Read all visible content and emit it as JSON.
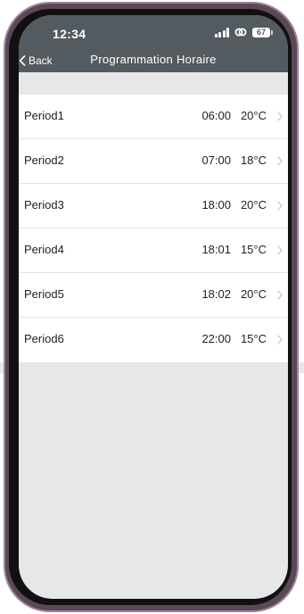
{
  "status_bar": {
    "time": "12:34",
    "battery": "67",
    "icons": [
      "signal-icon",
      "link-icon",
      "battery-icon"
    ]
  },
  "nav": {
    "back_label": "Back",
    "title": "Programmation Horaire"
  },
  "periods": [
    {
      "label": "Period1",
      "time": "06:00",
      "temp": "20°C"
    },
    {
      "label": "Period2",
      "time": "07:00",
      "temp": "18°C"
    },
    {
      "label": "Period3",
      "time": "18:00",
      "temp": "20°C"
    },
    {
      "label": "Period4",
      "time": "18:01",
      "temp": "15°C"
    },
    {
      "label": "Period5",
      "time": "18:02",
      "temp": "20°C"
    },
    {
      "label": "Period6",
      "time": "22:00",
      "temp": "15°C"
    }
  ],
  "colors": {
    "header_bg": "#545b60",
    "screen_bg": "#e6e7e8",
    "phone_frame": "#5b4857"
  }
}
